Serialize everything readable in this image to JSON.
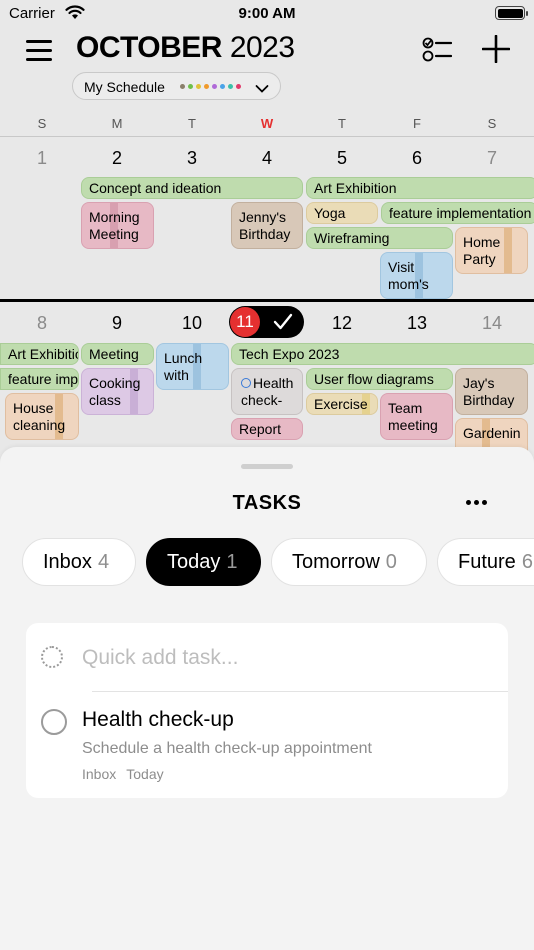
{
  "status_bar": {
    "carrier": "Carrier",
    "time": "9:00 AM"
  },
  "header": {
    "month": "OCTOBER",
    "year": "2023",
    "schedule_label": "My Schedule",
    "schedule_dot_colors": [
      "#8a7f6a",
      "#6fbf4a",
      "#e0c23a",
      "#f09a2c",
      "#b06ad8",
      "#4aa3e8",
      "#3bc0a8",
      "#e03a6a"
    ]
  },
  "weekdays": [
    "S",
    "M",
    "T",
    "W",
    "T",
    "F",
    "S"
  ],
  "week1": {
    "days": [
      "1",
      "2",
      "3",
      "4",
      "5",
      "6",
      "7"
    ],
    "events": {
      "concept": "Concept and ideation",
      "art": "Art Exhibition",
      "morning": "Morning Meeting",
      "jenny": "Jenny's Birthday",
      "yoga": "Yoga",
      "feature": "feature implementation",
      "wireframing": "Wireframing",
      "home": "Home Party",
      "visit": "Visit mom's"
    }
  },
  "week2": {
    "days": [
      "8",
      "9",
      "10",
      "11",
      "12",
      "13",
      "14"
    ],
    "events": {
      "art": "Art Exhibitio",
      "feature": "feature imp",
      "house": "House cleaning",
      "meeting": "Meeting",
      "cooking": "Cooking class",
      "lunch": "Lunch with",
      "tech": "Tech Expo 2023",
      "health": "Health check-",
      "report": "Report",
      "userflow": "User flow diagrams",
      "exercise": "Exercise",
      "team": "Team meeting",
      "jay": "Jay's Birthday",
      "gardening": "Gardenin"
    }
  },
  "sheet": {
    "title": "TASKS",
    "tabs": [
      {
        "label": "Inbox",
        "count": "4"
      },
      {
        "label": "Today",
        "count": "1"
      },
      {
        "label": "Tomorrow",
        "count": "0"
      },
      {
        "label": "Future",
        "count": "6"
      }
    ],
    "quick_add_placeholder": "Quick add task...",
    "task": {
      "title": "Health check-up",
      "description": "Schedule a health check-up appointment",
      "list": "Inbox",
      "due": "Today"
    }
  },
  "colors": {
    "today_red": "#e53030",
    "sunday_label_red": "#e53030"
  }
}
